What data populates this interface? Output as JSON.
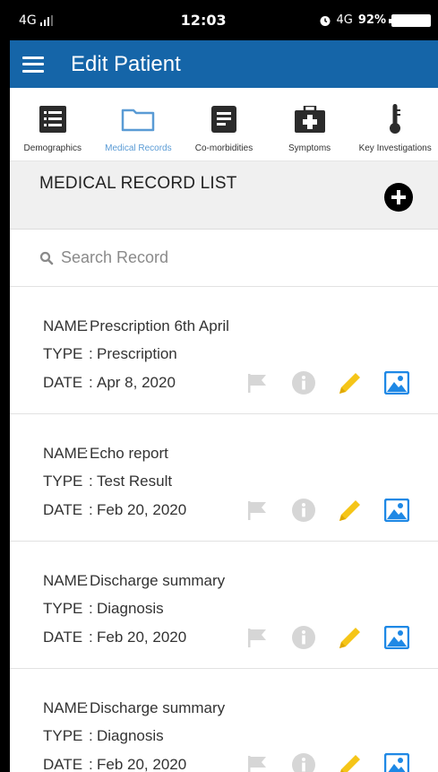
{
  "status_bar": {
    "network": "4G",
    "time": "12:03",
    "network_right": "4G",
    "battery": "92%"
  },
  "app_bar": {
    "title": "Edit Patient",
    "menu_icon": "hamburger-menu-icon"
  },
  "tabs": [
    {
      "label": "Demographics",
      "icon": "list-icon",
      "active": false
    },
    {
      "label": "Medical Records",
      "icon": "folder-icon",
      "active": true
    },
    {
      "label": "Co-morbidities",
      "icon": "document-icon",
      "active": false
    },
    {
      "label": "Symptoms",
      "icon": "first-aid-kit-icon",
      "active": false
    },
    {
      "label": "Key Investigations",
      "icon": "thermometer-icon",
      "active": false
    }
  ],
  "list": {
    "title": "MEDICAL RECORD LIST",
    "add_icon": "add-circle-icon"
  },
  "search": {
    "placeholder": "Search Record",
    "value": ""
  },
  "record_labels": {
    "name": "NAME",
    "type": "TYPE",
    "date": "DATE",
    "sep": ":"
  },
  "records": [
    {
      "name": "Prescription 6th April",
      "type": "Prescription",
      "date": "Apr 8, 2020"
    },
    {
      "name": "Echo report",
      "type": "Test Result",
      "date": "Feb 20, 2020"
    },
    {
      "name": "Discharge summary",
      "type": "Diagnosis",
      "date": "Feb 20, 2020"
    },
    {
      "name": "Discharge summary",
      "type": "Diagnosis",
      "date": "Feb 20, 2020"
    }
  ],
  "record_actions": {
    "flag_icon": "flag-icon",
    "info_icon": "info-icon",
    "edit_icon": "pencil-icon",
    "image_icon": "image-icon"
  },
  "colors": {
    "app_bar": "#1565a8",
    "active_tab": "#5a9bd5",
    "edit_icon": "#f5c518",
    "image_icon": "#1e88e5",
    "disabled_icon": "#d6d6d6"
  }
}
